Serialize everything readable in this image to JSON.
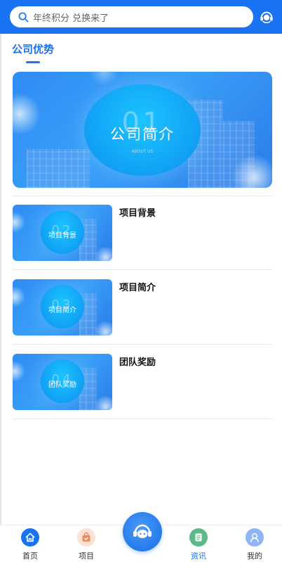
{
  "header": {
    "search_placeholder": "年终积分 兑换来了",
    "search_icon": "search-icon",
    "service_icon": "customer-service-icon"
  },
  "section": {
    "title": "公司优势"
  },
  "banner": {
    "number": "01",
    "title": "公司简介",
    "subtitle": "ABOUT US"
  },
  "items": [
    {
      "number": "02",
      "image_title": "项目背景",
      "title": "项目背景"
    },
    {
      "number": "03",
      "image_title": "项目简介",
      "title": "项目简介"
    },
    {
      "number": "04",
      "image_title": "团队奖励",
      "title": "团队奖励"
    }
  ],
  "bottom_nav": {
    "items": [
      {
        "label": "首页",
        "icon": "home-icon"
      },
      {
        "label": "项目",
        "icon": "project-bag-icon"
      },
      {
        "label": "资讯",
        "icon": "news-document-icon",
        "active": true
      },
      {
        "label": "我的",
        "icon": "user-icon"
      }
    ],
    "center_icon": "chat-headset-icon"
  },
  "colors": {
    "primary": "#1a73f0",
    "nav_home": "#1a73f0",
    "nav_project": "#f08a5d",
    "nav_news": "#5cb98a",
    "nav_mine": "#8fb5f7"
  }
}
